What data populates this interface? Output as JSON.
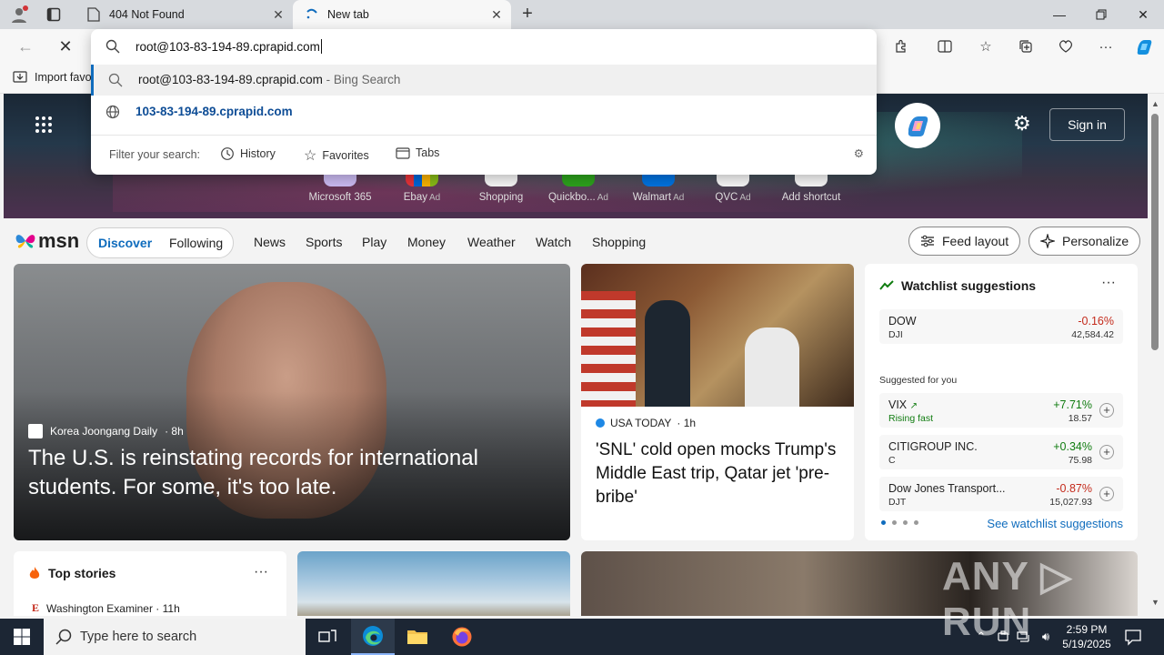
{
  "browser": {
    "tabs": [
      {
        "title": "404 Not Found"
      },
      {
        "title": "New tab"
      }
    ],
    "address": {
      "value": "root@103-83-194-89.cprapid.com"
    },
    "suggestions": [
      {
        "text": "root@103-83-194-89.cprapid.com",
        "hint": " - Bing Search"
      },
      {
        "text": "103-83-194-89.cprapid.com",
        "hint": ""
      }
    ],
    "filter": {
      "label": "Filter your search:",
      "history": "History",
      "favorites": "Favorites",
      "tabs": "Tabs"
    },
    "favorites_bar": {
      "import_label": "Import favo"
    }
  },
  "newtab": {
    "signin": "Sign in",
    "shortcuts": [
      {
        "label": "Microsoft 365",
        "ad": ""
      },
      {
        "label": "Ebay",
        "ad": "Ad"
      },
      {
        "label": "Shopping",
        "ad": ""
      },
      {
        "label": "Quickbo...",
        "ad": "Ad"
      },
      {
        "label": "Walmart",
        "ad": "Ad"
      },
      {
        "label": "QVC",
        "ad": "Ad"
      },
      {
        "label": "Add shortcut",
        "ad": ""
      }
    ]
  },
  "msn": {
    "logo": "msn",
    "pill": {
      "discover": "Discover",
      "following": "Following"
    },
    "nav": [
      "News",
      "Sports",
      "Play",
      "Money",
      "Weather",
      "Watch",
      "Shopping"
    ],
    "feed_layout": "Feed layout",
    "personalize": "Personalize"
  },
  "cards": {
    "big": {
      "source": "Korea Joongang Daily",
      "age": "· 8h",
      "headline": "The U.S. is reinstating records for international students. For some, it's too late."
    },
    "mid": {
      "source": "USA TODAY",
      "age": "· 1h",
      "headline": "'SNL' cold open mocks Trump's Middle East trip, Qatar jet 'pre-bribe'"
    },
    "watchlist": {
      "title": "Watchlist suggestions",
      "main": {
        "name": "DOW",
        "sub": "DJI",
        "change": "-0.16%",
        "price": "42,584.42"
      },
      "suggested_label": "Suggested for you",
      "items": [
        {
          "name": "VIX",
          "sub": "Rising fast",
          "change": "+7.71%",
          "price": "18.57"
        },
        {
          "name": "CITIGROUP INC.",
          "sub": "C",
          "change": "+0.34%",
          "price": "75.98"
        },
        {
          "name": "Dow Jones Transport...",
          "sub": "DJT",
          "change": "-0.87%",
          "price": "15,027.93"
        }
      ],
      "link": "See watchlist suggestions"
    },
    "top_stories": {
      "title": "Top stories",
      "first_source": "Washington Examiner · 11h"
    }
  },
  "watermark": "ANY ▷ RUN",
  "taskbar": {
    "search_placeholder": "Type here to search",
    "time": "2:59 PM",
    "date": "5/19/2025"
  },
  "colors": {
    "accent": "#0f6cbd",
    "negative": "#c42b1c",
    "positive": "#107c10",
    "taskbar": "#1c2634"
  }
}
